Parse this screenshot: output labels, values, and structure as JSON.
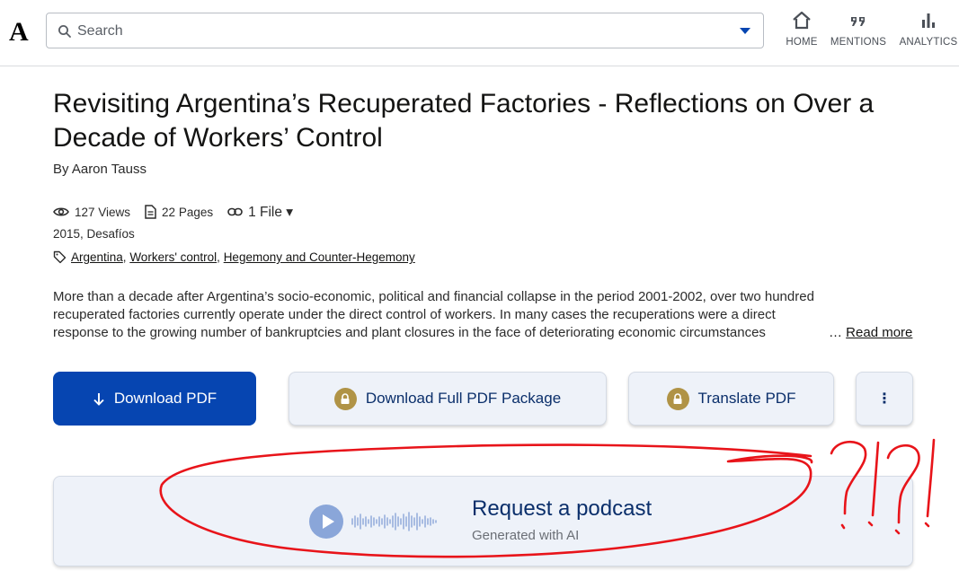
{
  "header": {
    "logo": "A",
    "search": {
      "placeholder": "Search"
    },
    "nav": [
      {
        "label": "HOME",
        "icon": "home-icon"
      },
      {
        "label": "MENTIONS",
        "icon": "quote-icon"
      },
      {
        "label": "ANALYTICS",
        "icon": "bar-chart-icon"
      }
    ]
  },
  "paper": {
    "title": "Revisiting Argentina’s Recuperated Factories - Reflections on Over a Decade of Workers’ Control",
    "author": "By Aaron Tauss",
    "views": "127 Views",
    "pages": "22 Pages",
    "files": "1 File ▾",
    "venue": "2015, Desafíos",
    "tags": [
      "Argentina",
      "Workers' control",
      "Hegemony and Counter-Hegemony"
    ],
    "abstract_lines": [
      "More than a decade after Argentina’s socio-economic, political and financial collapse in the period 2001-2002, over two hundred",
      "recuperated factories currently operate under the direct control of workers. In many cases the recuperations were a direct",
      "response to the growing number of bankruptcies and plant closures in the face of deteriorating economic circumstances"
    ],
    "ellipsis": "…",
    "read_more": "Read more"
  },
  "actions": {
    "download_pdf": "Download PDF",
    "download_package": "Download Full PDF Package",
    "translate_pdf": "Translate PDF",
    "more": "⋮"
  },
  "podcast": {
    "title": "Request a podcast",
    "subtitle": "Generated with AI"
  },
  "colors": {
    "primary": "#0645b1",
    "secondary_bg": "#eef2f9",
    "lock_gold": "#b09346",
    "annotation_red": "#e8141a"
  }
}
